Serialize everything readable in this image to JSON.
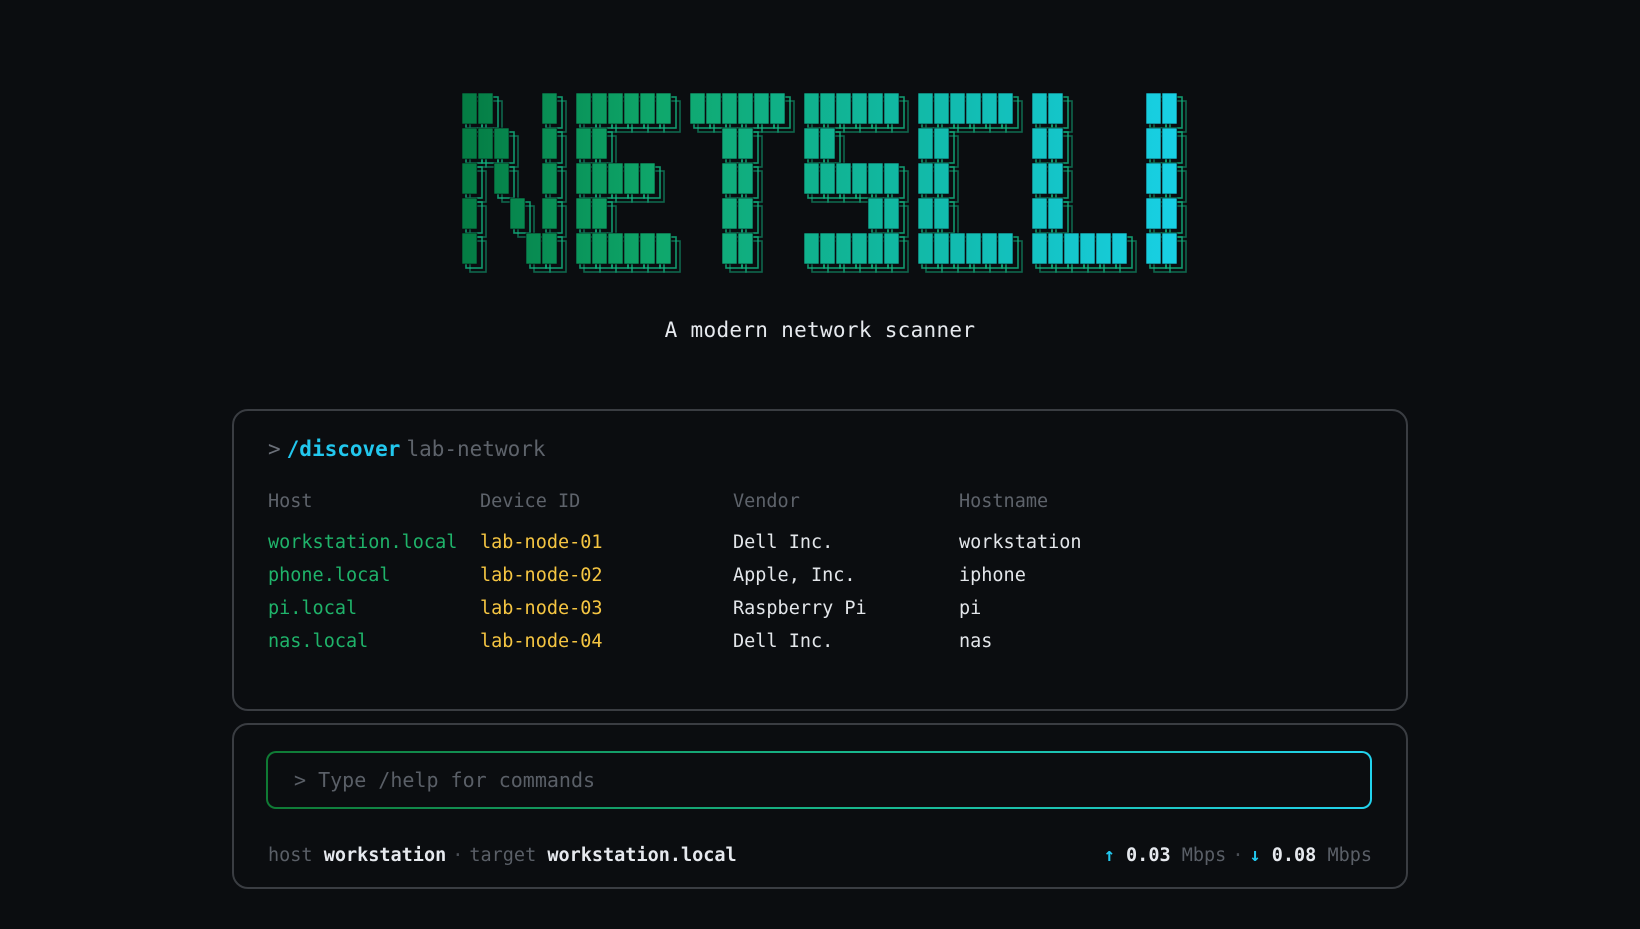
{
  "logo": {
    "text": "NETSCLI",
    "gradient": [
      "#007a3d",
      "#13a877",
      "#13c2c2",
      "#1ed8f8"
    ],
    "shadow_color": "#12b07e"
  },
  "tagline": "A modern network scanner",
  "output": {
    "prompt": ">",
    "command": "/discover",
    "argument": "lab-network",
    "columns": [
      "Host",
      "Device ID",
      "Vendor",
      "Hostname"
    ],
    "rows": [
      {
        "host": "workstation.local",
        "device_id": "lab-node-01",
        "vendor": "Dell Inc.",
        "hostname": "workstation"
      },
      {
        "host": "phone.local",
        "device_id": "lab-node-02",
        "vendor": "Apple, Inc.",
        "hostname": "iphone"
      },
      {
        "host": "pi.local",
        "device_id": "lab-node-03",
        "vendor": "Raspberry Pi",
        "hostname": "pi"
      },
      {
        "host": "nas.local",
        "device_id": "lab-node-04",
        "vendor": "Dell Inc.",
        "hostname": "nas"
      }
    ]
  },
  "input": {
    "placeholder": "> Type /help for commands",
    "value": ""
  },
  "status": {
    "host_label": "host",
    "host_value": "workstation",
    "separator": "·",
    "target_label": "target",
    "target_value": "workstation.local",
    "up_arrow": "↑",
    "up_value": "0.03",
    "down_arrow": "↓",
    "down_value": "0.08",
    "unit": "Mbps"
  },
  "colors": {
    "host": "#1fb36a",
    "device_id": "#f5c542",
    "command": "#22c7ee",
    "accent": "#22d3ee"
  }
}
